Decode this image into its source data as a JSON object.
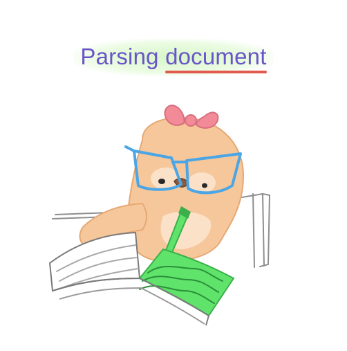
{
  "status": {
    "word_1": "Parsing",
    "word_2": "document"
  },
  "colors": {
    "text": "#6a55c8",
    "underline": "#e25a4d",
    "glow": "#d6f6c6",
    "fur": "#f6c79a",
    "bow": "#f28a97",
    "glasses": "#4aa6e6",
    "highlighter": "#5fe36a"
  },
  "icons": {
    "character": "sloth-reading-icon"
  }
}
